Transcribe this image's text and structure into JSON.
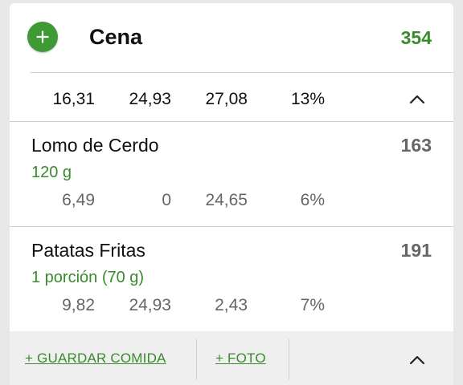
{
  "meal": {
    "title": "Cena",
    "calories": "354",
    "summary": [
      "16,31",
      "24,93",
      "27,08",
      "13%"
    ]
  },
  "foods": [
    {
      "name": "Lomo de Cerdo",
      "calories": "163",
      "serving": "120 g",
      "values": [
        "6,49",
        "0",
        "24,65",
        "6%"
      ]
    },
    {
      "name": "Patatas Fritas",
      "calories": "191",
      "serving": "1 porción (70 g)",
      "values": [
        "9,82",
        "24,93",
        "2,43",
        "7%"
      ]
    }
  ],
  "footer": {
    "save_meal": "+ GUARDAR COMIDA",
    "photo": "+ FOTO"
  },
  "colors": {
    "accent_green": "#3f9a35",
    "text_green": "#3a8a2e"
  },
  "icons": {
    "add": "plus-icon",
    "collapse": "chevron-up-icon"
  }
}
